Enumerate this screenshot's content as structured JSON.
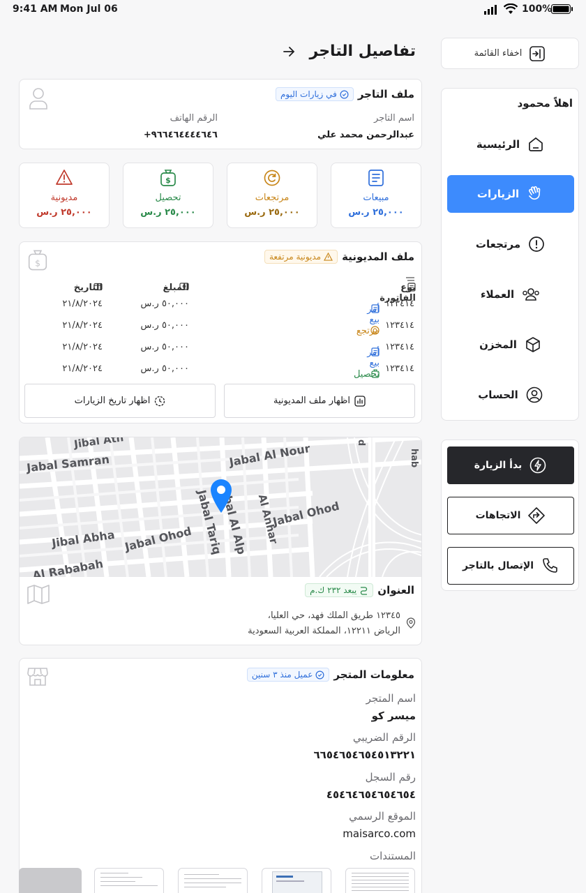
{
  "status": {
    "time": "9:41 AM",
    "date": "Mon Jul 06",
    "battery": "100%"
  },
  "header": {
    "title": "تفاصيل التاجر",
    "back_icon": "arrow-right-icon"
  },
  "sidebar": {
    "hide_label": "اخفاء القائمة",
    "greeting": "اهلاً محمود",
    "items": [
      {
        "label": "الرئيسية",
        "icon": "home-icon"
      },
      {
        "label": "الزيارات",
        "icon": "hand-wave-icon",
        "active": true
      },
      {
        "label": "مرتجعات",
        "icon": "alert-circle-icon"
      },
      {
        "label": "العملاء",
        "icon": "users-icon"
      },
      {
        "label": "المخزن",
        "icon": "box-icon"
      },
      {
        "label": "الحساب",
        "icon": "user-circle-icon"
      }
    ],
    "actions": {
      "start_visit": "بدأ الزيارة",
      "directions": "الاتجاهات",
      "call_merchant": "الإتصال بالتاجر"
    }
  },
  "merchant_profile": {
    "title": "ملف التاجر",
    "badge": "في زيارات اليوم",
    "name_label": "اسم التاجر",
    "name_value": "عبدالرحمن محمد علي",
    "phone_label": "الرقم الهاتف",
    "phone_value": "+٩٦٦٤٦٤٤٤٤٦٤٦"
  },
  "stats": [
    {
      "name": "مبيعات",
      "amount": "٢٥,٠٠٠ ر.س",
      "color": "#2f6fdb"
    },
    {
      "name": "مرتجعات",
      "amount": "٢٥,٠٠٠ ر.س",
      "color": "#c8861a"
    },
    {
      "name": "تحصيل",
      "amount": "٢٥,٠٠٠ ر.س",
      "color": "#2a8a4a"
    },
    {
      "name": "مديونية",
      "amount": "٢٥,٠٠٠ ر.س",
      "color": "#c0392b"
    }
  ],
  "debt": {
    "title": "ملف المديونية",
    "badge": "مديونية مرتفعة",
    "col_type": "نوع الفاتورة",
    "col_amount": "المبلغ",
    "col_date": "التاريخ",
    "rows": [
      {
        "id": "١٢٣٤١٤",
        "type": "أمر بيع",
        "type_color": "#2f6fdb",
        "amount": "٥٠,٠٠٠ ر.س",
        "date": "٢١/٨/٢٠٢٤"
      },
      {
        "id": "١٢٣٤١٤",
        "type": "مرتجع",
        "type_color": "#c8861a",
        "amount": "٥٠,٠٠٠ ر.س",
        "date": "٢١/٨/٢٠٢٤"
      },
      {
        "id": "١٢٣٤١٤",
        "type": "أمر بيع",
        "type_color": "#2f6fdb",
        "amount": "٥٠,٠٠٠ ر.س",
        "date": "٢١/٨/٢٠٢٤"
      },
      {
        "id": "١٢٣٤١٤",
        "type": "تحصيل",
        "type_color": "#2a8a4a",
        "amount": "٥٠,٠٠٠ ر.س",
        "date": "٢١/٨/٢٠٢٤"
      }
    ],
    "show_debt_btn": "اظهار ملف المديونية",
    "show_history_btn": "اظهار تاريخ الزيارات"
  },
  "map": {
    "labels": [
      "Jibal Ath",
      "Jabal Samran",
      "Jabal Al Nour",
      "Jebal Al Alp",
      "Jabal Tariq",
      "Al Anhar",
      "Jabal Ohod",
      "Jibal Abha",
      "Jabal Ohod",
      "Al Rababah",
      "hab",
      "d"
    ]
  },
  "address": {
    "title": "العنوان",
    "badge": "يبعد ٢٣٢ ك.م",
    "line1": "١٢٣٤٥ طريق الملك فهد، حي العليا،",
    "line2": "الرياض ١٢٢١١، المملكة العربية السعودية"
  },
  "store": {
    "title": "معلومات المتجر",
    "badge": "عميل منذ ٣ سنين",
    "fields": [
      {
        "label": "اسم المتجر",
        "value": "ميسر كو"
      },
      {
        "label": "الرقم الضريبي",
        "value": "٦٦٥٤٦٥٤٦٥٤٥١٣٢٢١"
      },
      {
        "label": "رقم السجل",
        "value": "٤٥٤٦٤٦٥٤٦٥٤٦٥٤"
      },
      {
        "label": "الموقع الرسمي",
        "value": "maisarco.com"
      }
    ],
    "docs_label": "المستندات"
  }
}
